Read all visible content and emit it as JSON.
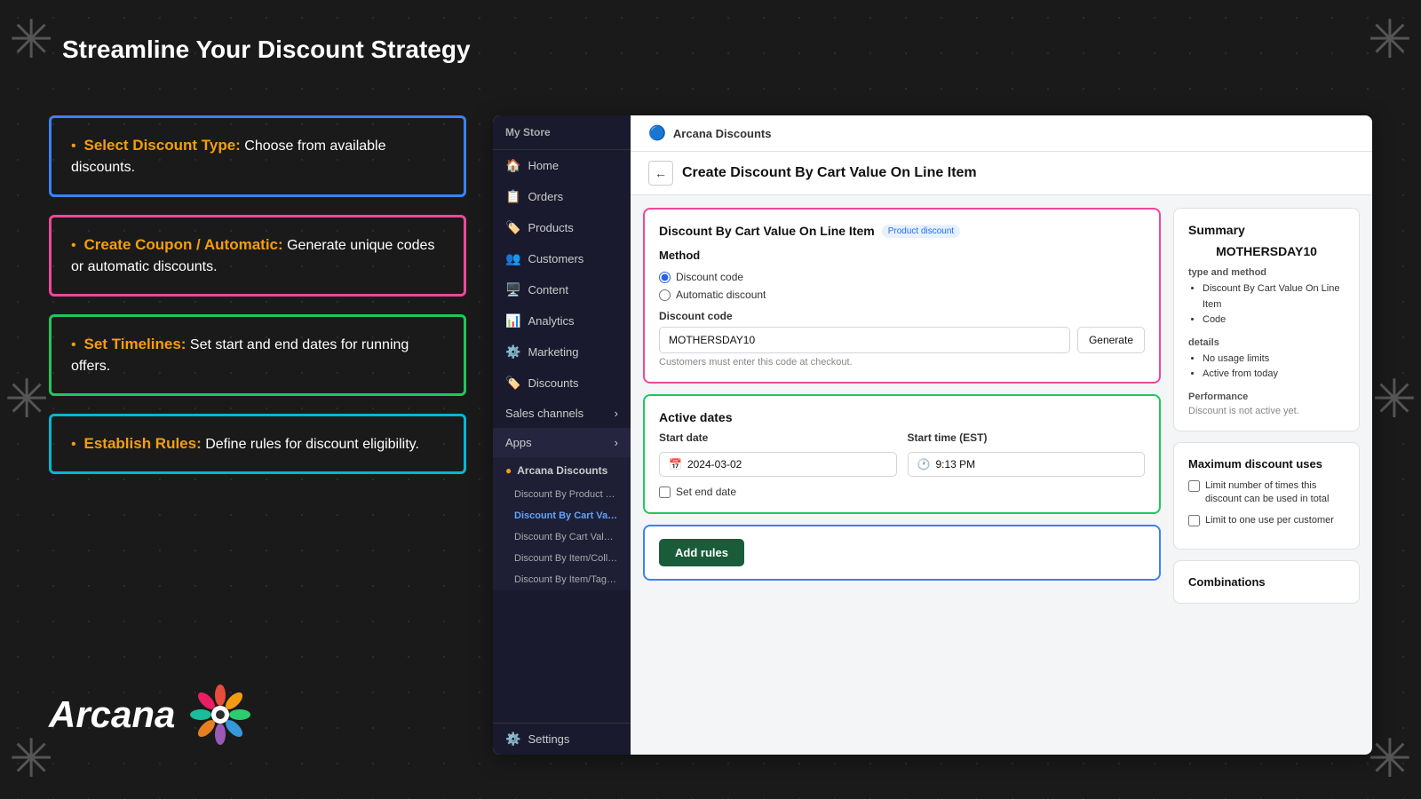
{
  "page": {
    "title": "Streamline Your Discount Strategy",
    "background": "#1a1a1a"
  },
  "bullets": [
    {
      "id": "select",
      "border_color": "#3b82f6",
      "label": "Select Discount Type:",
      "text": " Choose from available discounts."
    },
    {
      "id": "create",
      "border_color": "#ec4899",
      "label": "Create Coupon / Automatic:",
      "text": " Generate unique codes  or automatic discounts."
    },
    {
      "id": "timelines",
      "border_color": "#22c55e",
      "label": "Set Timelines:",
      "text": " Set start and end dates for running offers."
    },
    {
      "id": "rules",
      "border_color": "#06b6d4",
      "label": "Establish Rules:",
      "text": " Define rules for discount eligibility."
    }
  ],
  "logo": {
    "text": "Arcana"
  },
  "sidebar": {
    "items": [
      {
        "id": "home",
        "icon": "🏠",
        "label": "Home"
      },
      {
        "id": "orders",
        "icon": "📋",
        "label": "Orders"
      },
      {
        "id": "products",
        "icon": "🏷️",
        "label": "Products"
      },
      {
        "id": "customers",
        "icon": "👥",
        "label": "Customers"
      },
      {
        "id": "content",
        "icon": "🖥️",
        "label": "Content"
      },
      {
        "id": "analytics",
        "icon": "📊",
        "label": "Analytics"
      },
      {
        "id": "marketing",
        "icon": "⚙️",
        "label": "Marketing"
      },
      {
        "id": "discounts",
        "icon": "🏷️",
        "label": "Discounts"
      }
    ],
    "sales_channels_label": "Sales channels",
    "apps_label": "Apps",
    "arcana_discounts_label": "Arcana Discounts",
    "app_sub_items": [
      {
        "id": "product-tag",
        "label": "Discount By Product Tag",
        "active": false
      },
      {
        "id": "cart-value-line",
        "label": "Discount By Cart Value ...",
        "active": true
      },
      {
        "id": "cart-value2",
        "label": "Discount By Cart Value ...",
        "active": false
      },
      {
        "id": "item-collect",
        "label": "Discount By Item/Collect...",
        "active": false
      },
      {
        "id": "item-tagge",
        "label": "Discount By Item/Tagge...",
        "active": false
      }
    ],
    "settings_label": "Settings"
  },
  "topbar": {
    "app_name": "Arcana Discounts"
  },
  "page_header": {
    "title": "Create Discount By Cart Value On Line Item",
    "back_label": "←"
  },
  "method_card": {
    "title": "Discount By Cart Value On Line Item",
    "badge": "Product discount",
    "method_label": "Method",
    "options": [
      {
        "id": "code",
        "label": "Discount code",
        "checked": true
      },
      {
        "id": "auto",
        "label": "Automatic discount",
        "checked": false
      }
    ],
    "discount_code_label": "Discount code",
    "discount_code_value": "MOTHERSDAY10",
    "generate_label": "Generate",
    "hint": "Customers must enter this code at checkout."
  },
  "active_dates_card": {
    "title": "Active dates",
    "start_date_label": "Start date",
    "start_date_value": "2024-03-02",
    "start_time_label": "Start time (EST)",
    "start_time_value": "9:13 PM",
    "set_end_date_label": "Set end date"
  },
  "add_rules": {
    "button_label": "Add rules"
  },
  "summary": {
    "title": "Summary",
    "code": "MOTHERSDAY10",
    "type_method_label": "type and method",
    "type_method_items": [
      "Discount By Cart Value On Line Item",
      "Code"
    ],
    "details_label": "details",
    "details_items": [
      "No usage limits",
      "Active from today"
    ],
    "performance_label": "Performance",
    "performance_text": "Discount is not active yet."
  },
  "max_uses": {
    "title": "Maximum discount uses",
    "items": [
      "Limit number of times this discount can be used in total",
      "Limit to one use per customer"
    ]
  },
  "combinations": {
    "title": "Combinations"
  }
}
